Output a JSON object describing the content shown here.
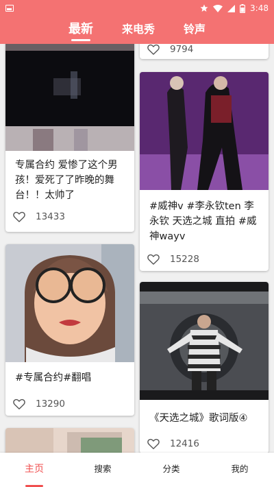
{
  "status_bar": {
    "time": "3:48"
  },
  "top_tabs": [
    {
      "label": "最新"
    },
    {
      "label": "来电秀"
    },
    {
      "label": "铃声"
    }
  ],
  "feed": {
    "cards": [
      {
        "caption": "",
        "likes": "9794"
      },
      {
        "caption": "专属合约 爱惨了这个男孩！爱死了了昨晚的舞台！！太帅了",
        "likes": "13433"
      },
      {
        "caption": "#威神v #李永钦ten 李永钦 天选之城 直拍 #威神wayv",
        "likes": "15228"
      },
      {
        "caption": "#专属合约#翻唱",
        "likes": "13290"
      },
      {
        "caption": "《天选之城》歌词版④",
        "likes": "12416"
      }
    ]
  },
  "bottom_nav": [
    {
      "label": "主页"
    },
    {
      "label": "搜索"
    },
    {
      "label": "分类"
    },
    {
      "label": "我的"
    }
  ],
  "colors": {
    "accent": "#f47272",
    "active_nav": "#f05050"
  },
  "icons": [
    "image-icon",
    "notification-icon",
    "wifi-icon",
    "signal-icon",
    "battery-icon",
    "heart-icon"
  ]
}
